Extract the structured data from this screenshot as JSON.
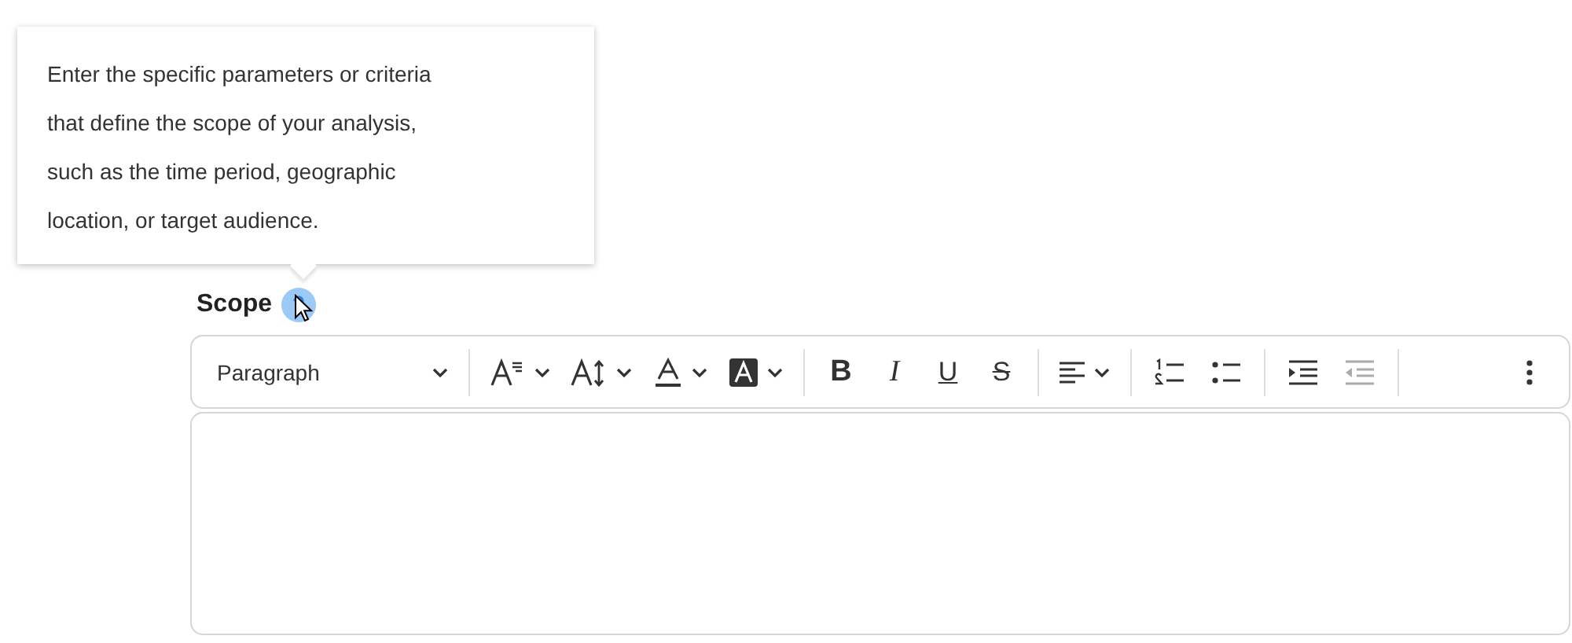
{
  "tooltip": {
    "text": "Enter the specific parameters or criteria that define the scope of your analysis, such as the time period, geographic location, or target audience."
  },
  "field": {
    "label": "Scope",
    "help_hovered": true
  },
  "toolbar": {
    "style_select": {
      "value": "Paragraph"
    },
    "format_buttons": [
      {
        "label": "B"
      },
      {
        "label": "I"
      },
      {
        "label": "U"
      },
      {
        "label": "S"
      }
    ],
    "outdent": {
      "disabled": true
    }
  }
}
